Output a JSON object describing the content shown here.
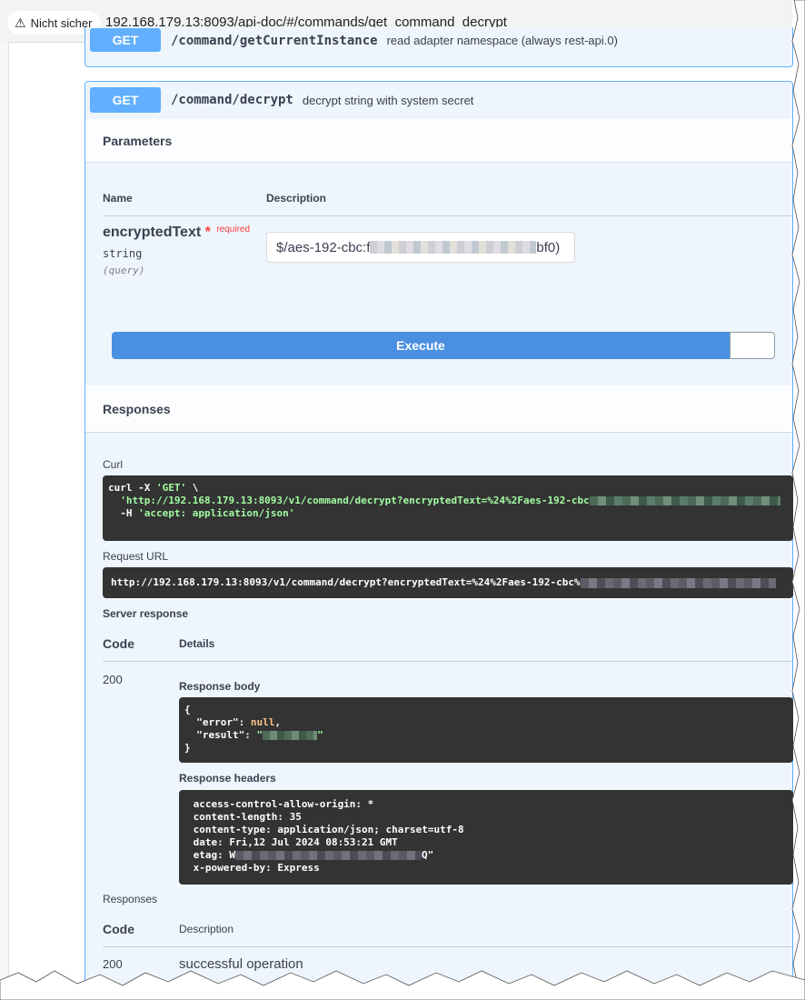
{
  "browser": {
    "security_label": "Nicht sicher",
    "url": "192.168.179.13:8093/api-doc/#/commands/get_command_decrypt"
  },
  "op_prev": {
    "method": "GET",
    "path": "/command/getCurrentInstance",
    "description": "read adapter namespace (always rest-api.0)"
  },
  "op": {
    "method": "GET",
    "path": "/command/decrypt",
    "description": "decrypt string with system secret",
    "parameters_title": "Parameters",
    "col_name": "Name",
    "col_description": "Description",
    "param_name": "encryptedText",
    "param_required_star": "*",
    "param_required": "required",
    "param_type": "string",
    "param_in": "(query)",
    "param_value_prefix": "$/aes-192-cbc:f",
    "param_value_suffix": "bf0)",
    "execute_label": "Execute",
    "responses_title": "Responses"
  },
  "curl": {
    "title": "Curl",
    "line1_cmd": "curl -X ",
    "line1_method": "'GET'",
    "line1_end": " \\",
    "line2": "  'http://192.168.179.13:8093/v1/command/decrypt?encryptedText=%24%2Faes-192-cbc",
    "line3_flag": "  -H ",
    "line3_val": "'accept: application/json'"
  },
  "request_url": {
    "title": "Request URL",
    "value": "http://192.168.179.13:8093/v1/command/decrypt?encryptedText=%24%2Faes-192-cbc%"
  },
  "server_response": {
    "title": "Server response",
    "col_code": "Code",
    "col_details": "Details",
    "code": "200",
    "body_title": "Response body",
    "body_open": "{",
    "body_error_key": "  \"error\": ",
    "body_error_val": "null",
    "body_error_comma": ",",
    "body_result_key": "  \"result\": ",
    "body_result_open": "\"",
    "body_result_close": "\"",
    "body_close": "}",
    "headers_title": "Response headers",
    "headers": [
      " access-control-allow-origin: *",
      " content-length: 35",
      " content-type: application/json; charset=utf-8",
      " date: Fri,12 Jul 2024 08:53:21 GMT"
    ],
    "etag_prefix": " etag: W",
    "etag_suffix": "Q\"",
    "powered_by": " x-powered-by: Express"
  },
  "responses": {
    "title": "Responses",
    "col_code": "Code",
    "col_description": "Description",
    "code": "200",
    "description": "successful operation"
  }
}
